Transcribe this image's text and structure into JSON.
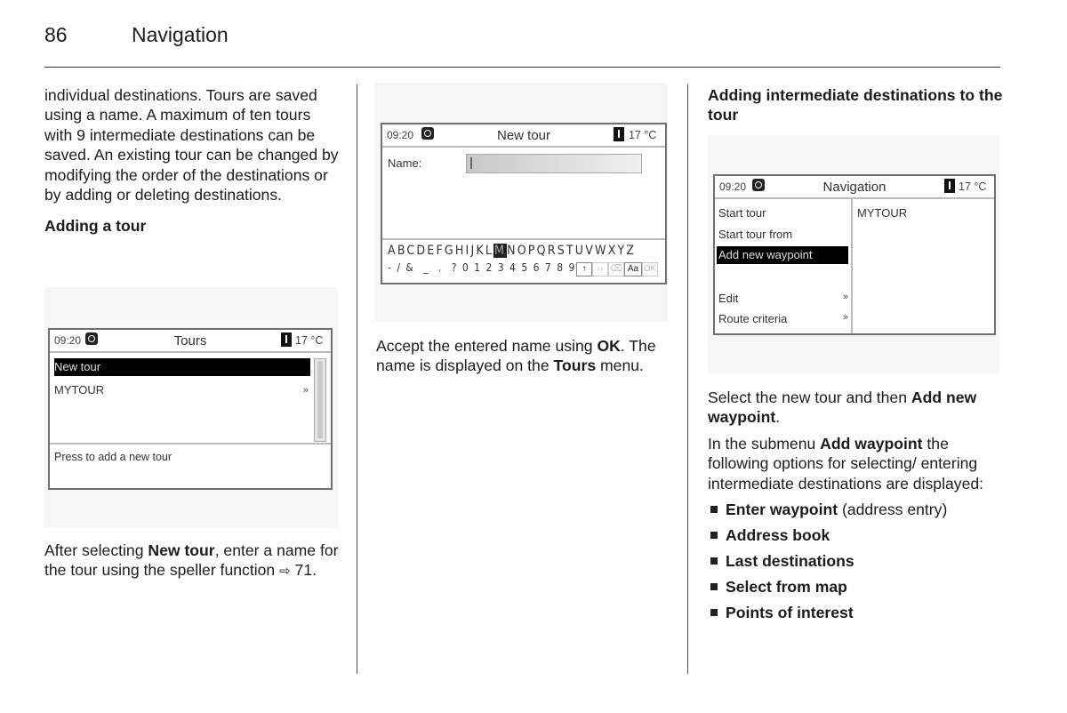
{
  "page": {
    "number": "86",
    "section_title": "Navigation"
  },
  "col1": {
    "intro": "individual destinations. Tours are saved using a name. A maximum of ten tours with 9 intermediate destinations can be saved. An existing tour can be changed by modifying the order of the destinations or by adding or deleting destinations.",
    "heading": "Adding a tour",
    "caption_pre": "After selecting ",
    "caption_bold": "New tour",
    "caption_post": ", enter a name for the tour using the speller function",
    "caption_ref_icon": "arrow-right-icon",
    "caption_ref": " 71."
  },
  "tours_screen": {
    "time": "09:20",
    "title": "Tours",
    "temp": "17 °C",
    "items": [
      {
        "label": "New tour",
        "selected": true,
        "submenu": false
      },
      {
        "label": "MYTOUR",
        "selected": false,
        "submenu": true
      }
    ],
    "hint": "Press to add a new tour"
  },
  "col2": {
    "caption_1": "Accept the entered name using ",
    "caption_1_bold": "OK",
    "caption_2": ". The name is displayed on the ",
    "caption_2_bold": "Tours",
    "caption_3": " menu."
  },
  "newtour_screen": {
    "time": "09:20",
    "title": "New tour",
    "temp": "17 °C",
    "name_label": "Name:",
    "name_value": "",
    "keyboard_row1_a": "ABCDEFGHIJKL",
    "keyboard_selected": "M",
    "keyboard_row1_b": "NOPQRSTUVWXYZ",
    "keyboard_row2": "- / &  _  .  ? 0 1 2 3 4 5 6 7 8 9",
    "controls": {
      "shift": "↑",
      "cursor": "‹›",
      "backspace": "⌫",
      "case": "Aa",
      "ok": "OK"
    }
  },
  "col3": {
    "heading": "Adding intermediate destinations to the tour",
    "p1_pre": "Select the new tour and then ",
    "p1_bold": "Add new waypoint",
    "p1_post": ".",
    "p2_pre": "In the submenu ",
    "p2_bold": "Add waypoint",
    "p2_post": " the following options for selecting/ entering intermediate destinations are displayed:",
    "bullets": [
      {
        "bold": "Enter waypoint",
        "rest": " (address entry)"
      },
      {
        "bold": "Address book",
        "rest": ""
      },
      {
        "bold": "Last destinations",
        "rest": ""
      },
      {
        "bold": "Select from map",
        "rest": ""
      },
      {
        "bold": "Points of interest",
        "rest": ""
      }
    ]
  },
  "nav_screen": {
    "time": "09:20",
    "title": "Navigation",
    "temp": "17 °C",
    "menu": [
      {
        "label": "Start tour",
        "selected": false,
        "submenu": false
      },
      {
        "label": "Start tour from",
        "selected": false,
        "submenu": false
      },
      {
        "label": "Add new waypoint",
        "selected": true,
        "submenu": false
      },
      {
        "label": "Edit",
        "selected": false,
        "submenu": true
      },
      {
        "label": "Route criteria",
        "selected": false,
        "submenu": true
      }
    ],
    "right_panel": "MYTOUR"
  }
}
